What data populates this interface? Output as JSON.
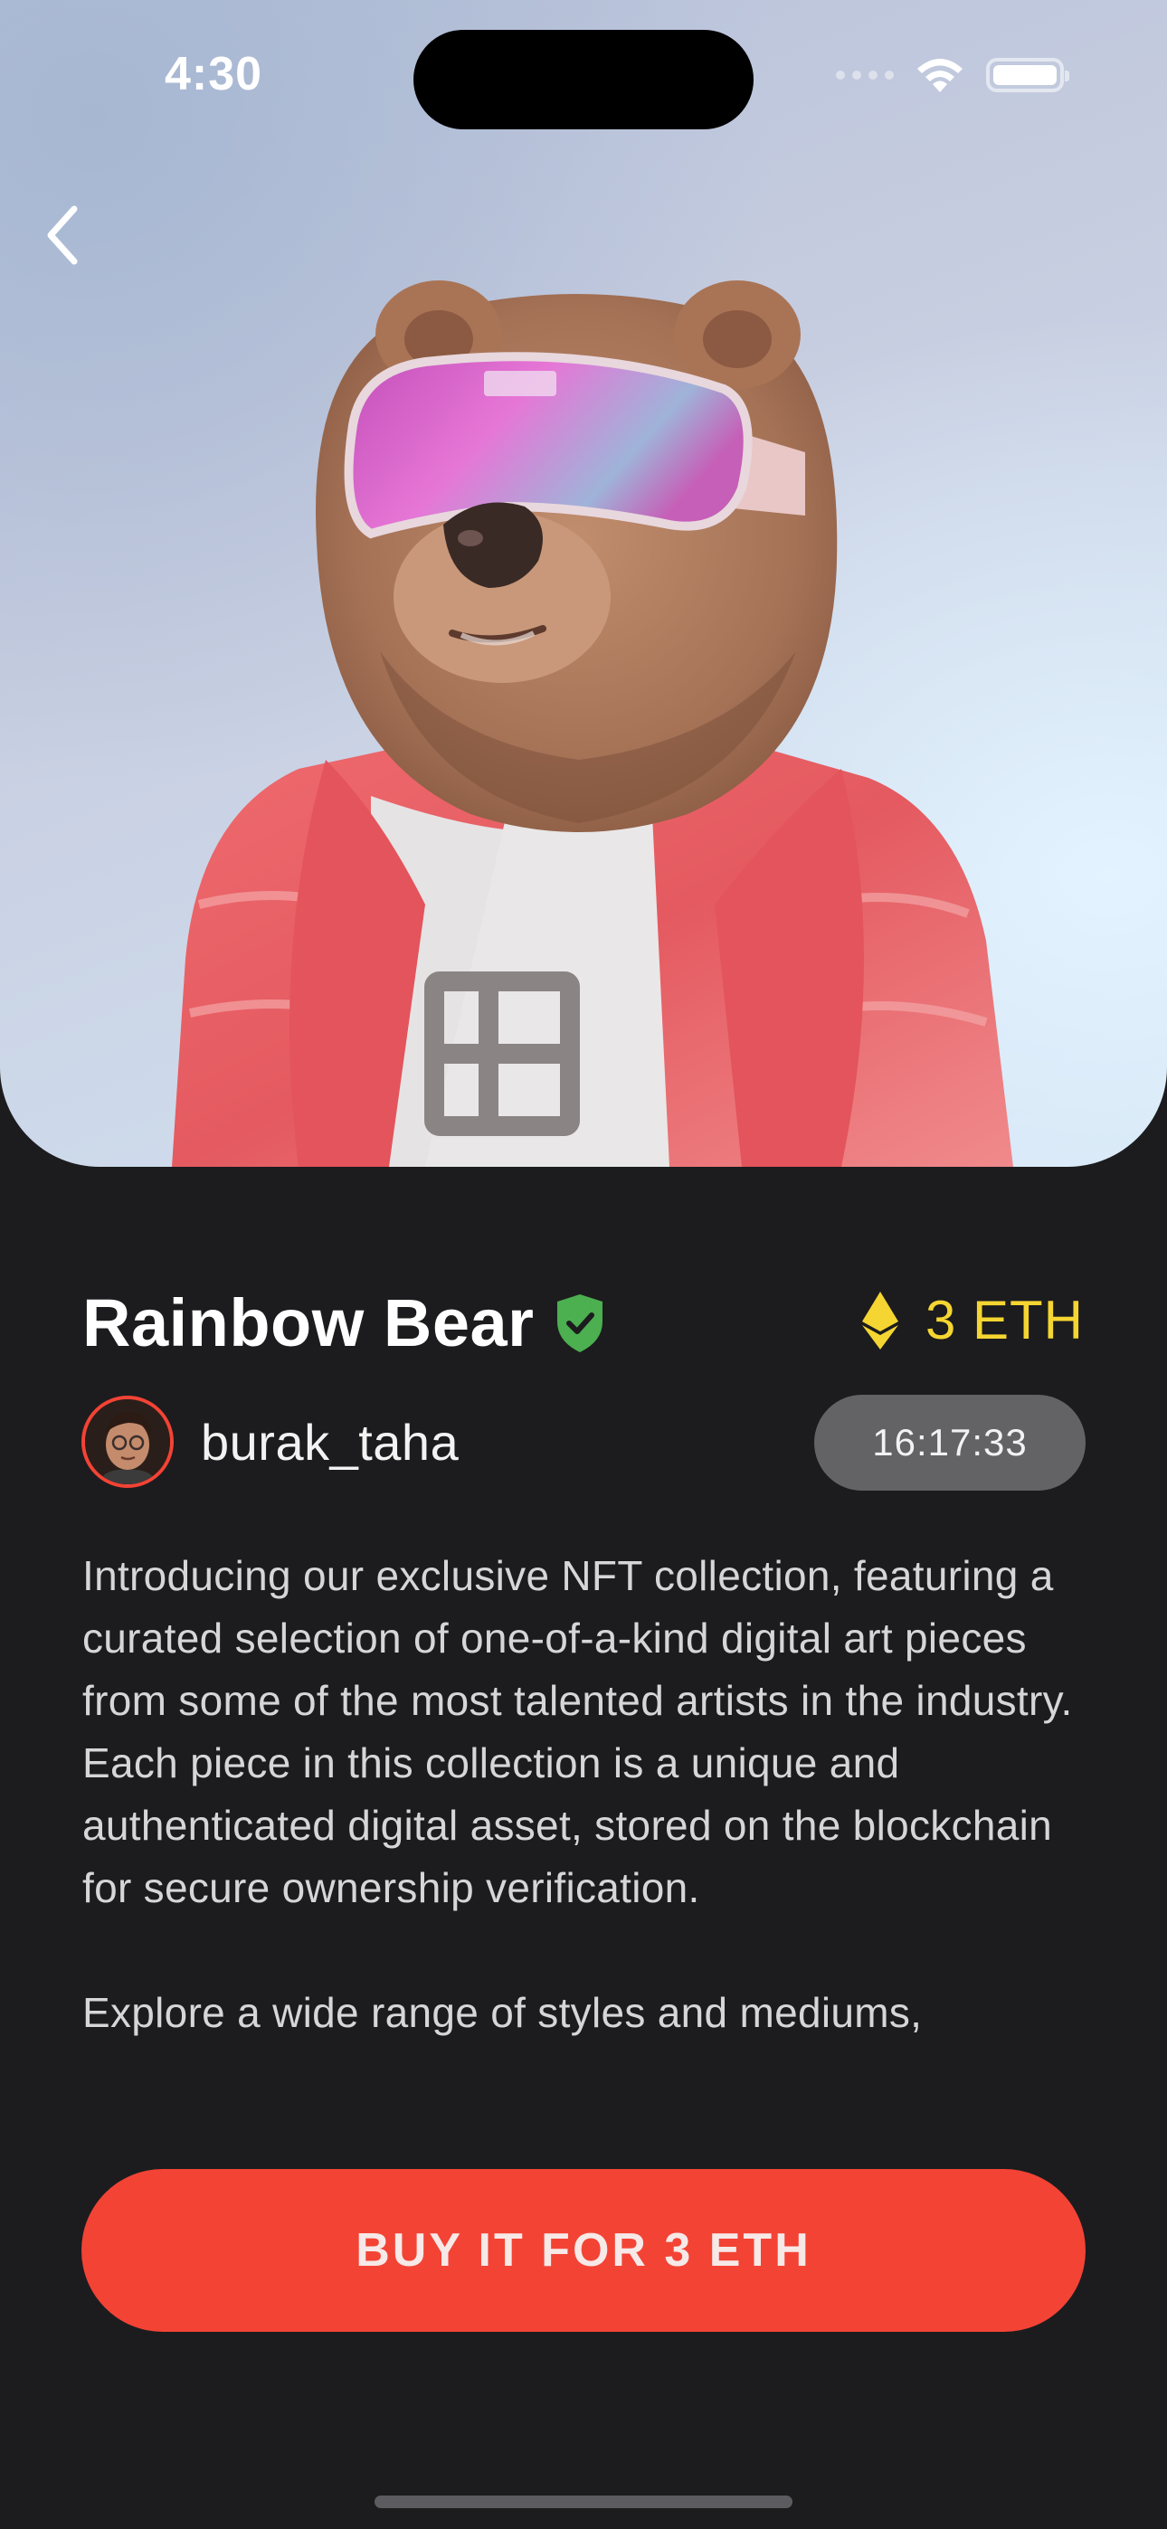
{
  "status_bar": {
    "time": "4:30"
  },
  "nft": {
    "title": "Rainbow Bear",
    "price": "3 ETH",
    "owner": "burak_taha",
    "timer": "16:17:33",
    "description": [
      "Introducing our exclusive NFT collection, featuring a curated selection of one-of-a-kind digital art pieces from some of the most talented artists in the industry. Each piece in this collection is a unique and authenticated digital asset, stored on the blockchain for secure ownership verification.",
      "Explore a wide range of styles and mediums,"
    ]
  },
  "actions": {
    "buy_label": "BUY IT FOR 3 ETH"
  },
  "colors": {
    "background": "#1c1c1e",
    "accent": "#f34335",
    "price": "#f5d531",
    "verified": "#4caf50",
    "timer_bg": "#636366"
  },
  "icons": {
    "back": "chevron-left-icon",
    "verified": "verified-shield-icon",
    "currency": "ethereum-icon",
    "wifi": "wifi-icon",
    "battery": "battery-icon"
  }
}
